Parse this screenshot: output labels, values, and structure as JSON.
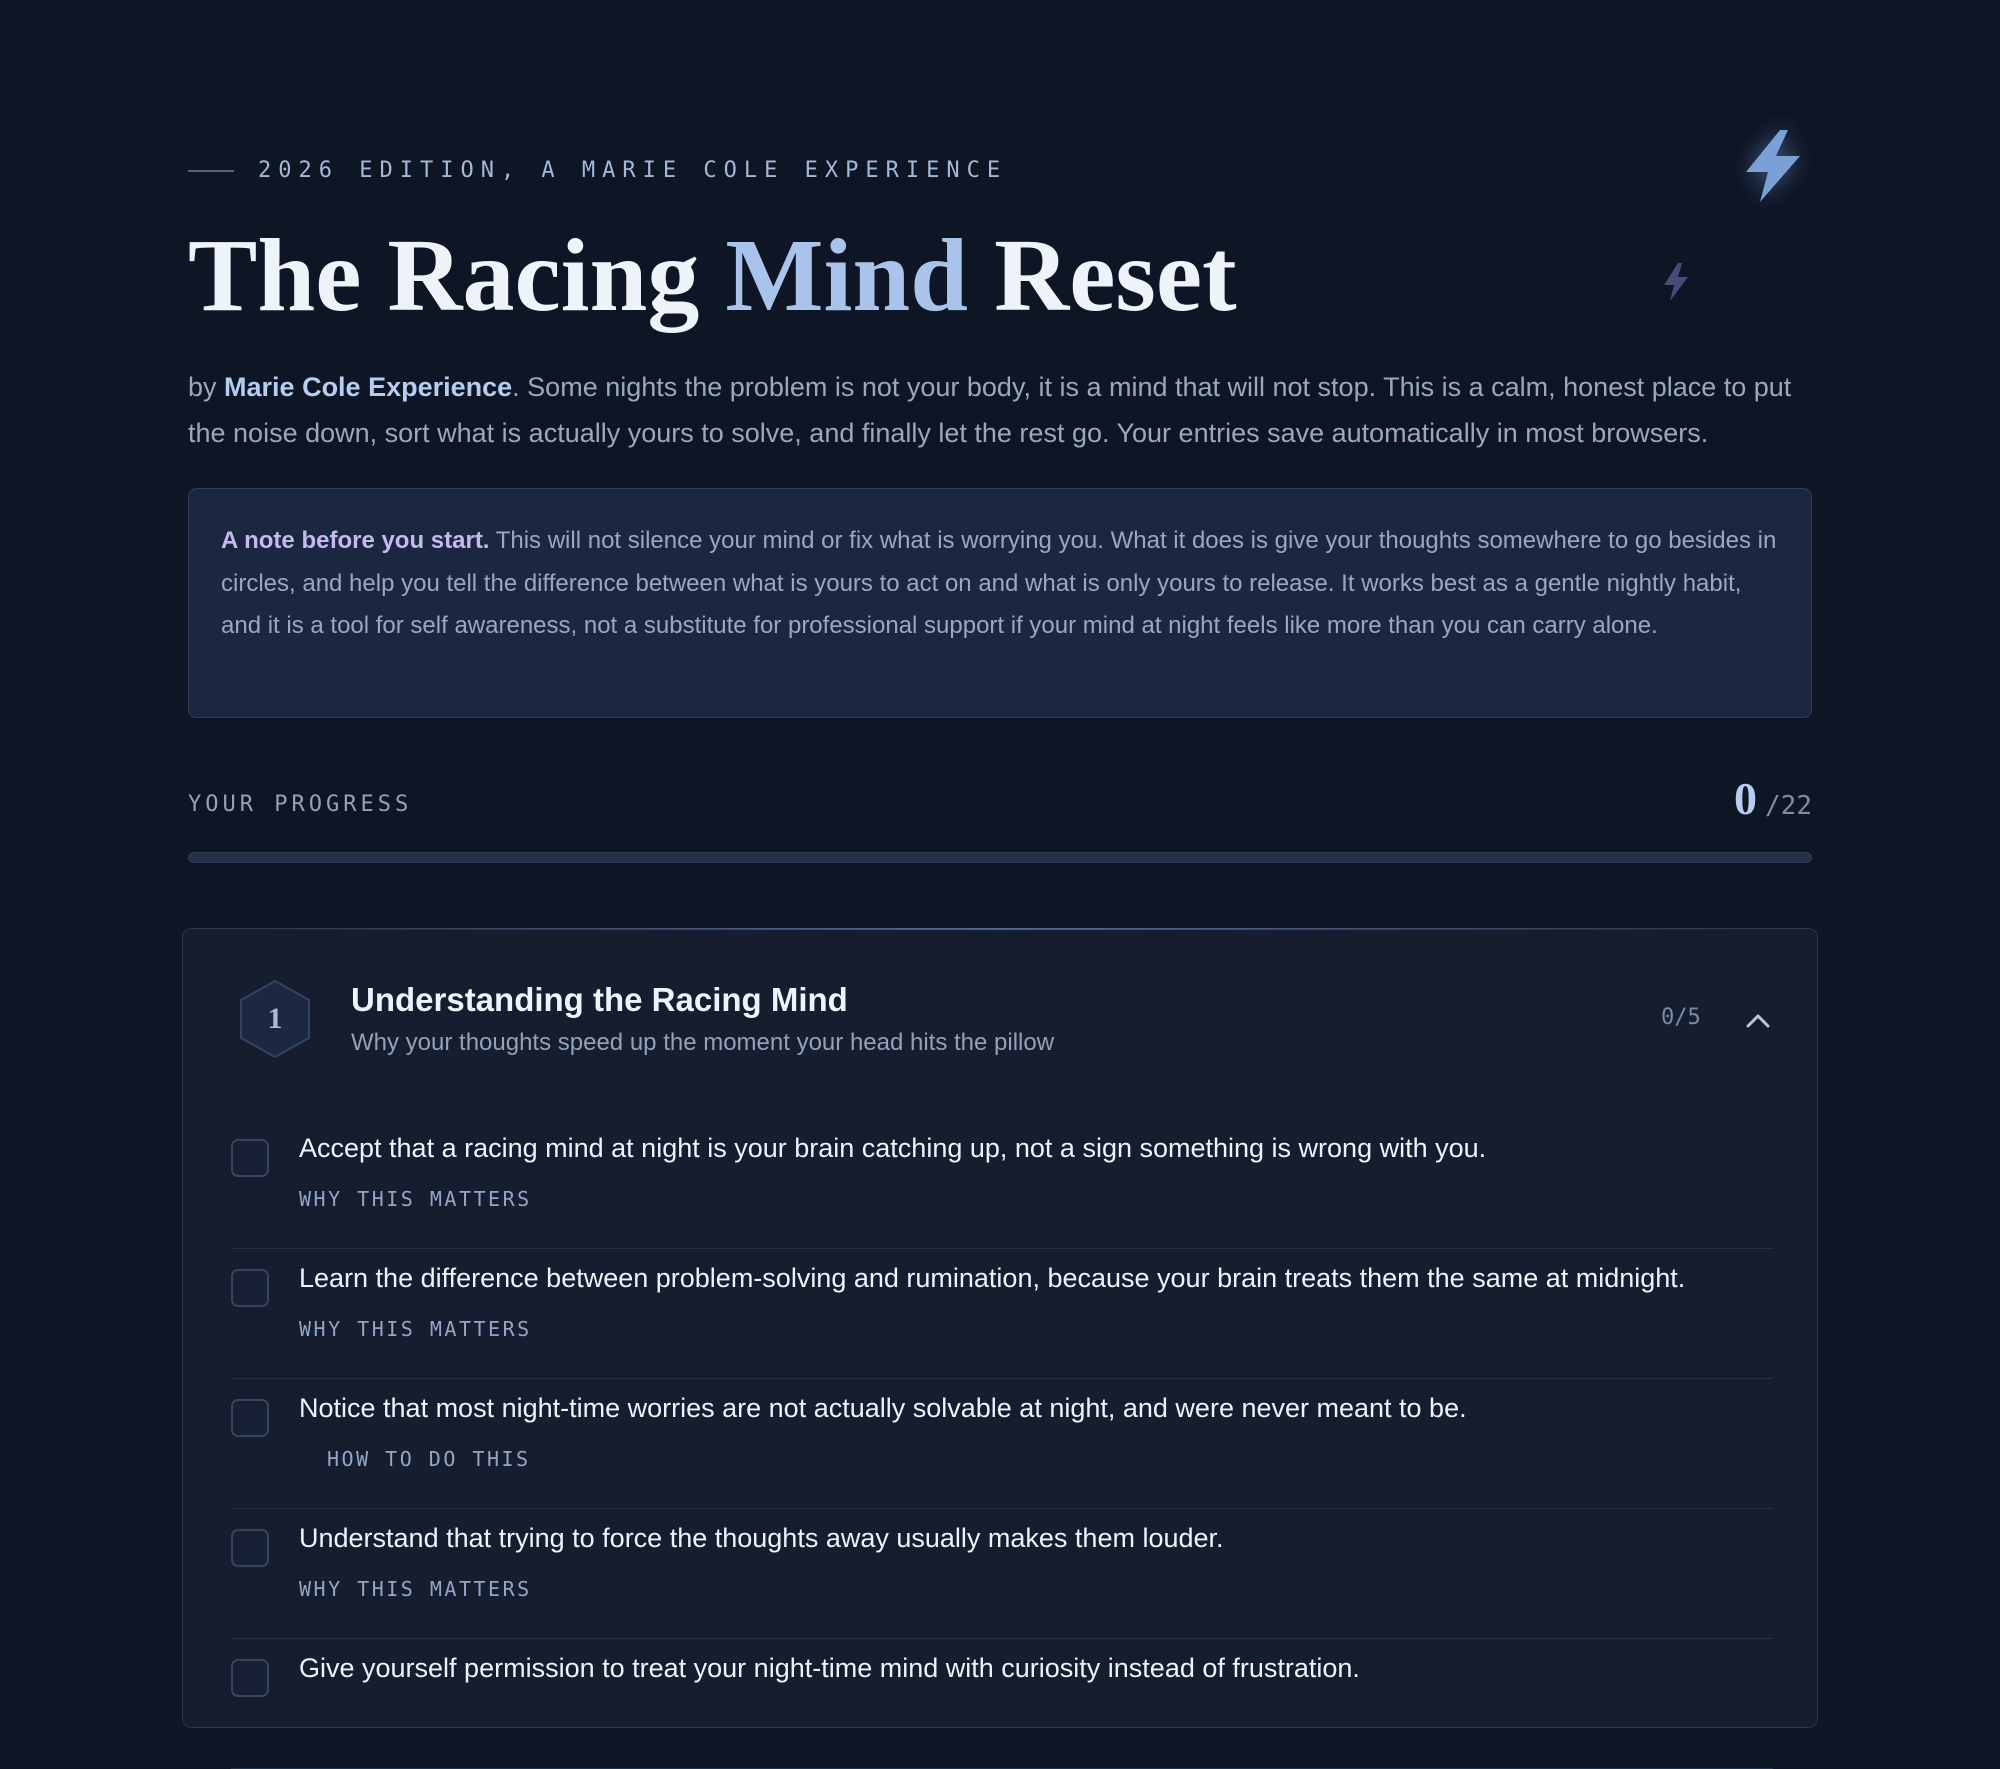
{
  "header": {
    "eyebrow": "2026 EDITION, A MARIE COLE EXPERIENCE",
    "title_part1": "The Racing ",
    "title_accent": "Mind",
    "title_part2": " Reset",
    "intro_by": "by ",
    "intro_author": "Marie Cole Experience",
    "intro_rest": ". Some nights the problem is not your body, it is a mind that will not stop. This is a calm, honest place to put the noise down, sort what is actually yours to solve, and finally let the rest go. Your entries save automatically in most browsers."
  },
  "note": {
    "lead": "A note before you start.",
    "body": " This will not silence your mind or fix what is worrying you. What it does is give your thoughts somewhere to go besides in circles, and help you tell the difference between what is yours to act on and what is only yours to release. It works best as a gentle nightly habit, and it is a tool for self awareness, not a substitute for professional support if your mind at night feels like more than you can carry alone."
  },
  "progress": {
    "label": "YOUR PROGRESS",
    "done": "0",
    "total": "/22",
    "fraction": 0
  },
  "section": {
    "number": "1",
    "title": "Understanding the Racing Mind",
    "subtitle": "Why your thoughts speed up the moment your head hits the pillow",
    "count": "0/5",
    "items": [
      {
        "text": "Accept that a racing mind at night is your brain catching up, not a sign something is wrong with you.",
        "meta": "WHY THIS MATTERS"
      },
      {
        "text": "Learn the difference between problem-solving and rumination, because your brain treats them the same at midnight.",
        "meta": "WHY THIS MATTERS"
      },
      {
        "text": "Notice that most night-time worries are not actually solvable at night, and were never meant to be.",
        "meta": "HOW TO DO THIS"
      },
      {
        "text": "Understand that trying to force the thoughts away usually makes them louder.",
        "meta": "WHY THIS MATTERS"
      },
      {
        "text": "Give yourself permission to treat your night-time mind with curiosity instead of frustration.",
        "meta": ""
      }
    ]
  },
  "icons": {
    "bolt_large": "lightning-bolt",
    "bolt_small": "lightning-bolt",
    "collapse": "chevron-up"
  },
  "colors": {
    "background": "#0e1524",
    "accent": "#a9c3ea",
    "note_lead": "#c7b8ef"
  }
}
